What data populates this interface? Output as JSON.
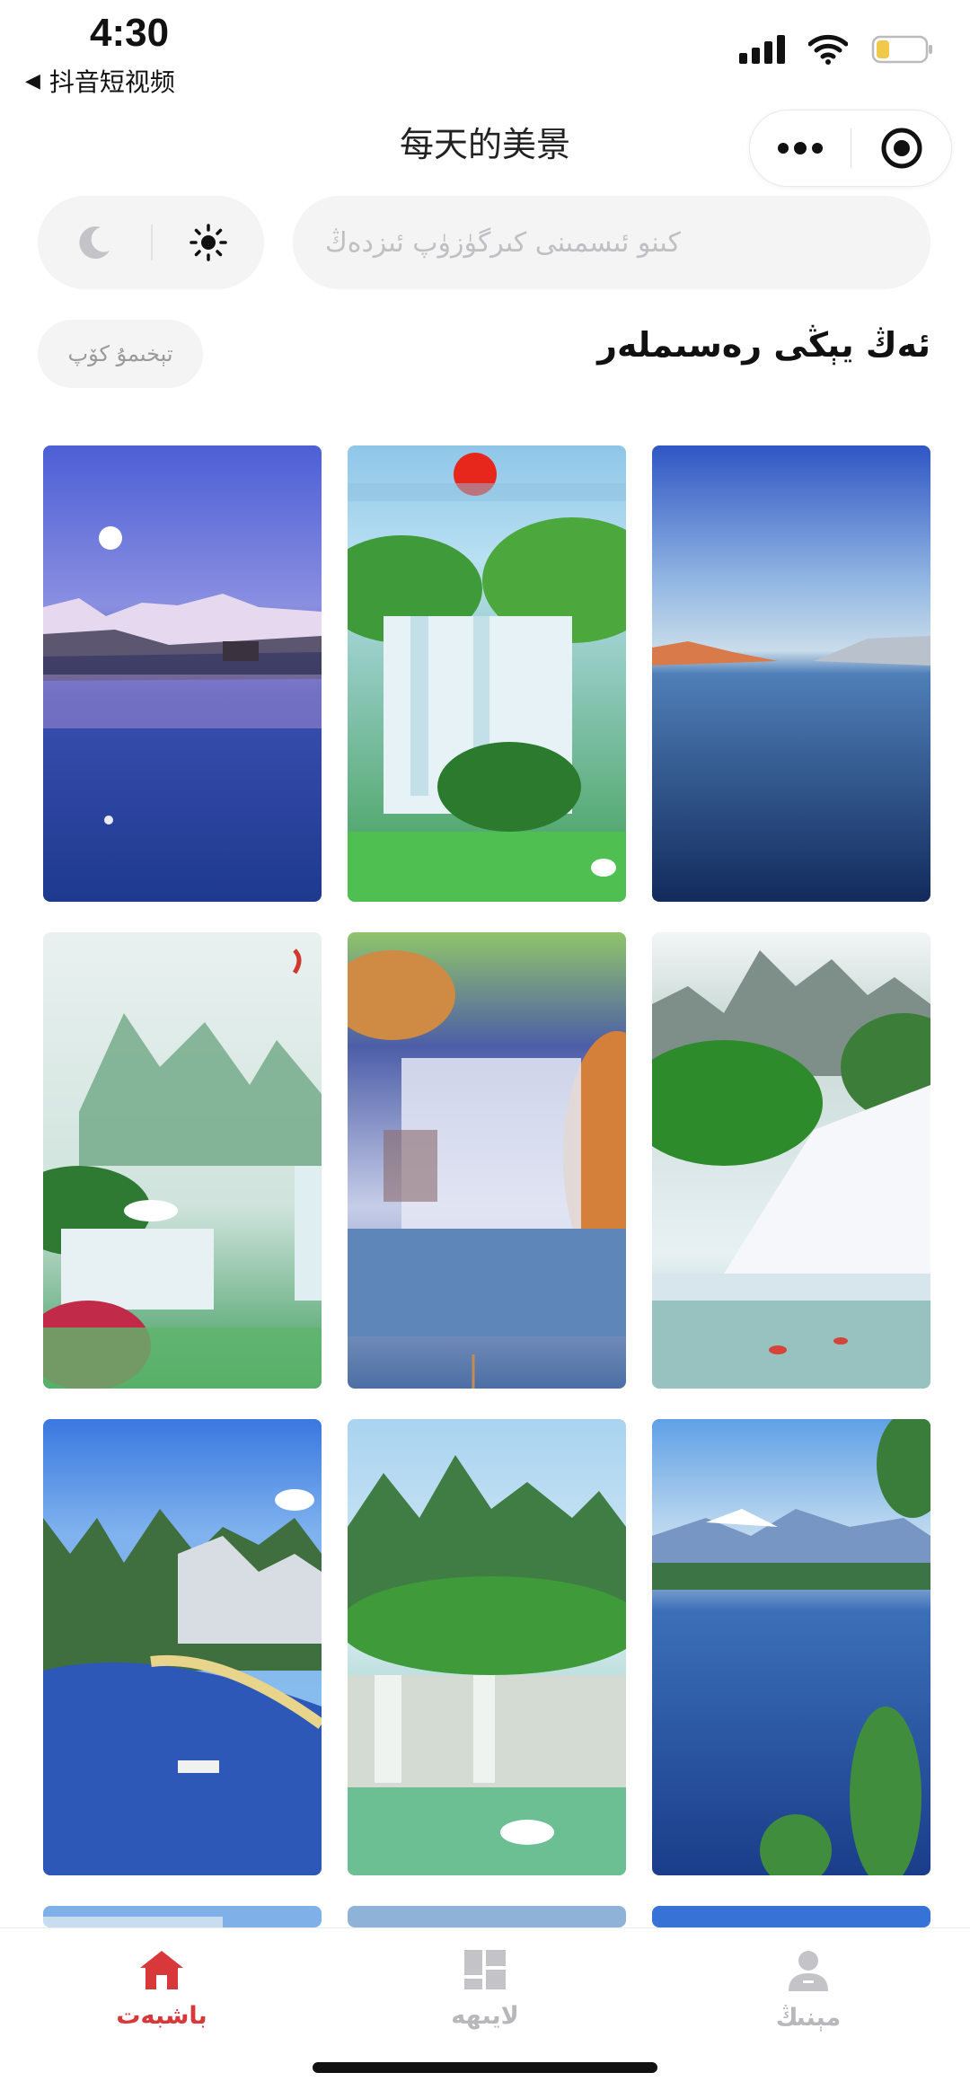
{
  "status_bar": {
    "time": "4:30",
    "back_app": "抖音短视频",
    "icons": [
      "signal-icon",
      "wifi-icon",
      "battery-icon"
    ]
  },
  "nav": {
    "title": "每天的美景",
    "capsule_icons": [
      "more-icon",
      "target-icon"
    ]
  },
  "toolbar": {
    "theme_icons": [
      "moon-icon",
      "sun-icon"
    ],
    "search_placeholder": "كىنو ئىسمىنى كىرگۈزۈپ ئىزدەڭ"
  },
  "section": {
    "title": "ئەڭ يېڭى رەسىملەر",
    "more_label": "تېخىمۇ كۆپ"
  },
  "gallery": {
    "items": [
      "moon-lake-mountains",
      "waterfall-sun-crane",
      "calm-blue-lake",
      "misty-mountains-cranes",
      "cascading-stream",
      "waterfall-koi-pond",
      "guilin-river-boat",
      "karst-waterfall-swans",
      "alpine-lake-reflection",
      "partial-image-1",
      "partial-image-2",
      "partial-image-3"
    ]
  },
  "tabbar": {
    "items": [
      {
        "label": "باشبەت",
        "icon": "home-icon",
        "active": true
      },
      {
        "label": "لايىھە",
        "icon": "grid-icon",
        "active": false
      },
      {
        "label": "مېنىڭ",
        "icon": "profile-icon",
        "active": false
      }
    ]
  },
  "colors": {
    "accent": "#d8383a",
    "inactive": "#b8b8bc",
    "surface": "#f4f4f5"
  }
}
